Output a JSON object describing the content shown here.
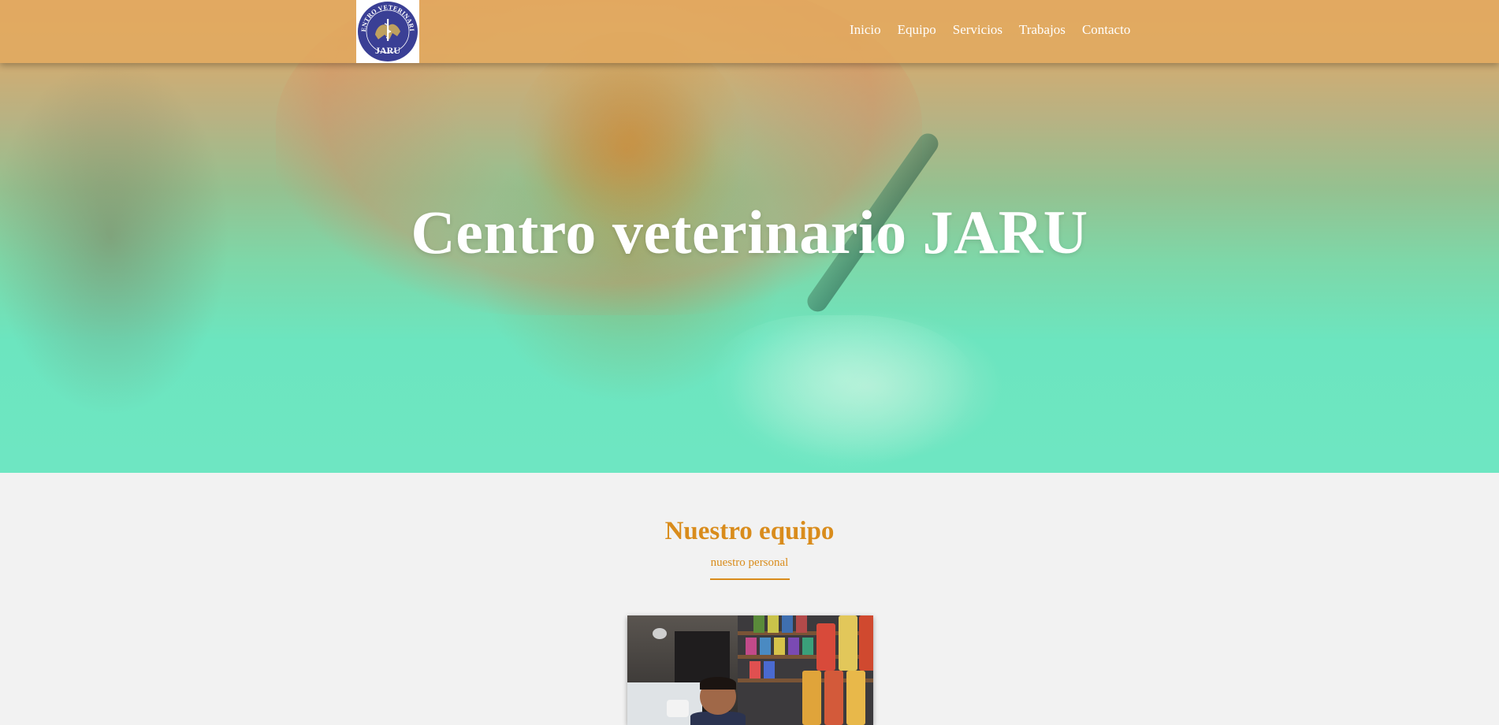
{
  "navbar": {
    "logo": {
      "top_text": "CENTRO VETERINARIO",
      "bottom_text": "JARU"
    },
    "links": [
      "Inicio",
      "Equipo",
      "Servicios",
      "Trabajos",
      "Contacto"
    ]
  },
  "hero": {
    "title": "Centro veterinario JARU"
  },
  "team": {
    "title": "Nuestro equipo",
    "subtitle": "nuestro personal"
  },
  "colors": {
    "accent": "#d98c1c",
    "logo_blue": "#3a3f95",
    "nav_bg": "#e2aa5f",
    "hero_bottom": "#6ee6c2"
  }
}
